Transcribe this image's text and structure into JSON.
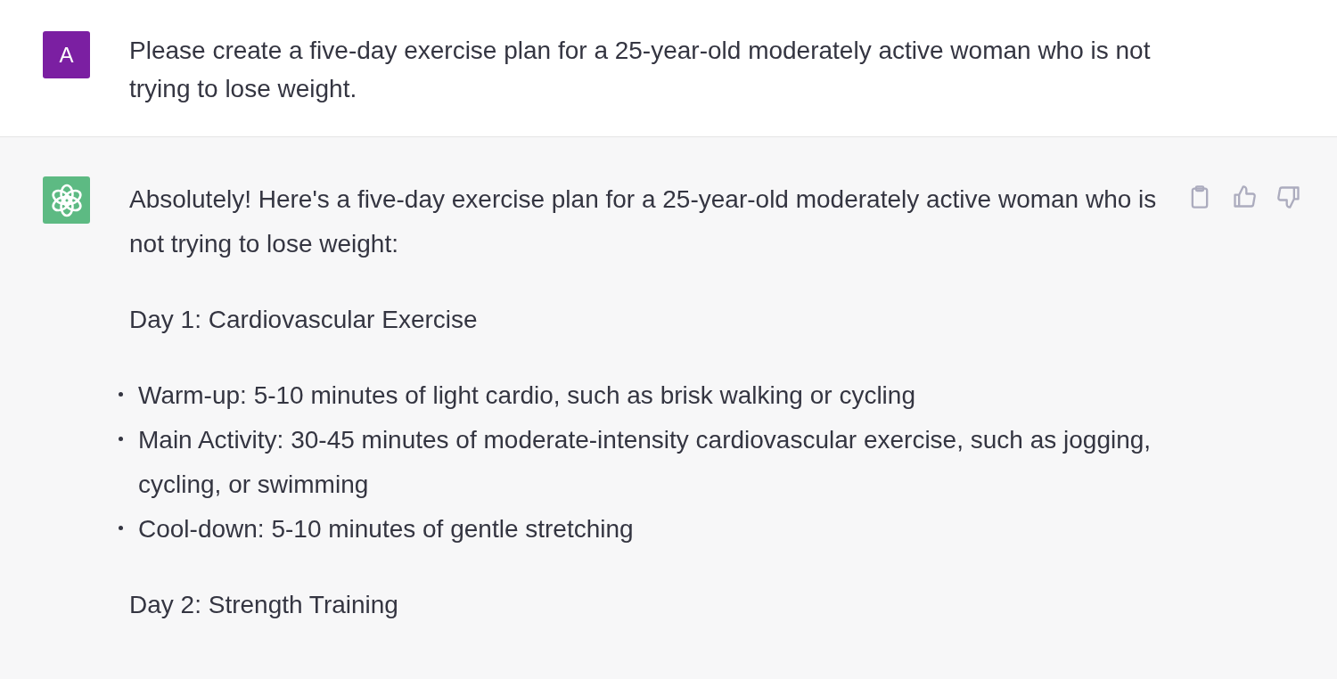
{
  "messages": [
    {
      "kind": "user",
      "avatar_letter": "A",
      "blocks": [
        {
          "kind": "paragraph",
          "text": "Please create a five-day exercise plan for a 25-year-old moderately active woman who is not trying to lose weight."
        }
      ]
    },
    {
      "kind": "assistant",
      "blocks": [
        {
          "kind": "paragraph",
          "text": "Absolutely! Here's a five-day exercise plan for a 25-year-old moderately active woman who is not trying to lose weight:"
        },
        {
          "kind": "paragraph",
          "text": "Day 1: Cardiovascular Exercise"
        },
        {
          "kind": "list",
          "items": [
            "Warm-up: 5-10 minutes of light cardio, such as brisk walking or cycling",
            "Main Activity: 30-45 minutes of moderate-intensity cardiovascular exercise, such as jogging, cycling, or swimming",
            "Cool-down: 5-10 minutes of gentle stretching"
          ]
        },
        {
          "kind": "paragraph",
          "text": "Day 2: Strength Training"
        }
      ]
    }
  ]
}
